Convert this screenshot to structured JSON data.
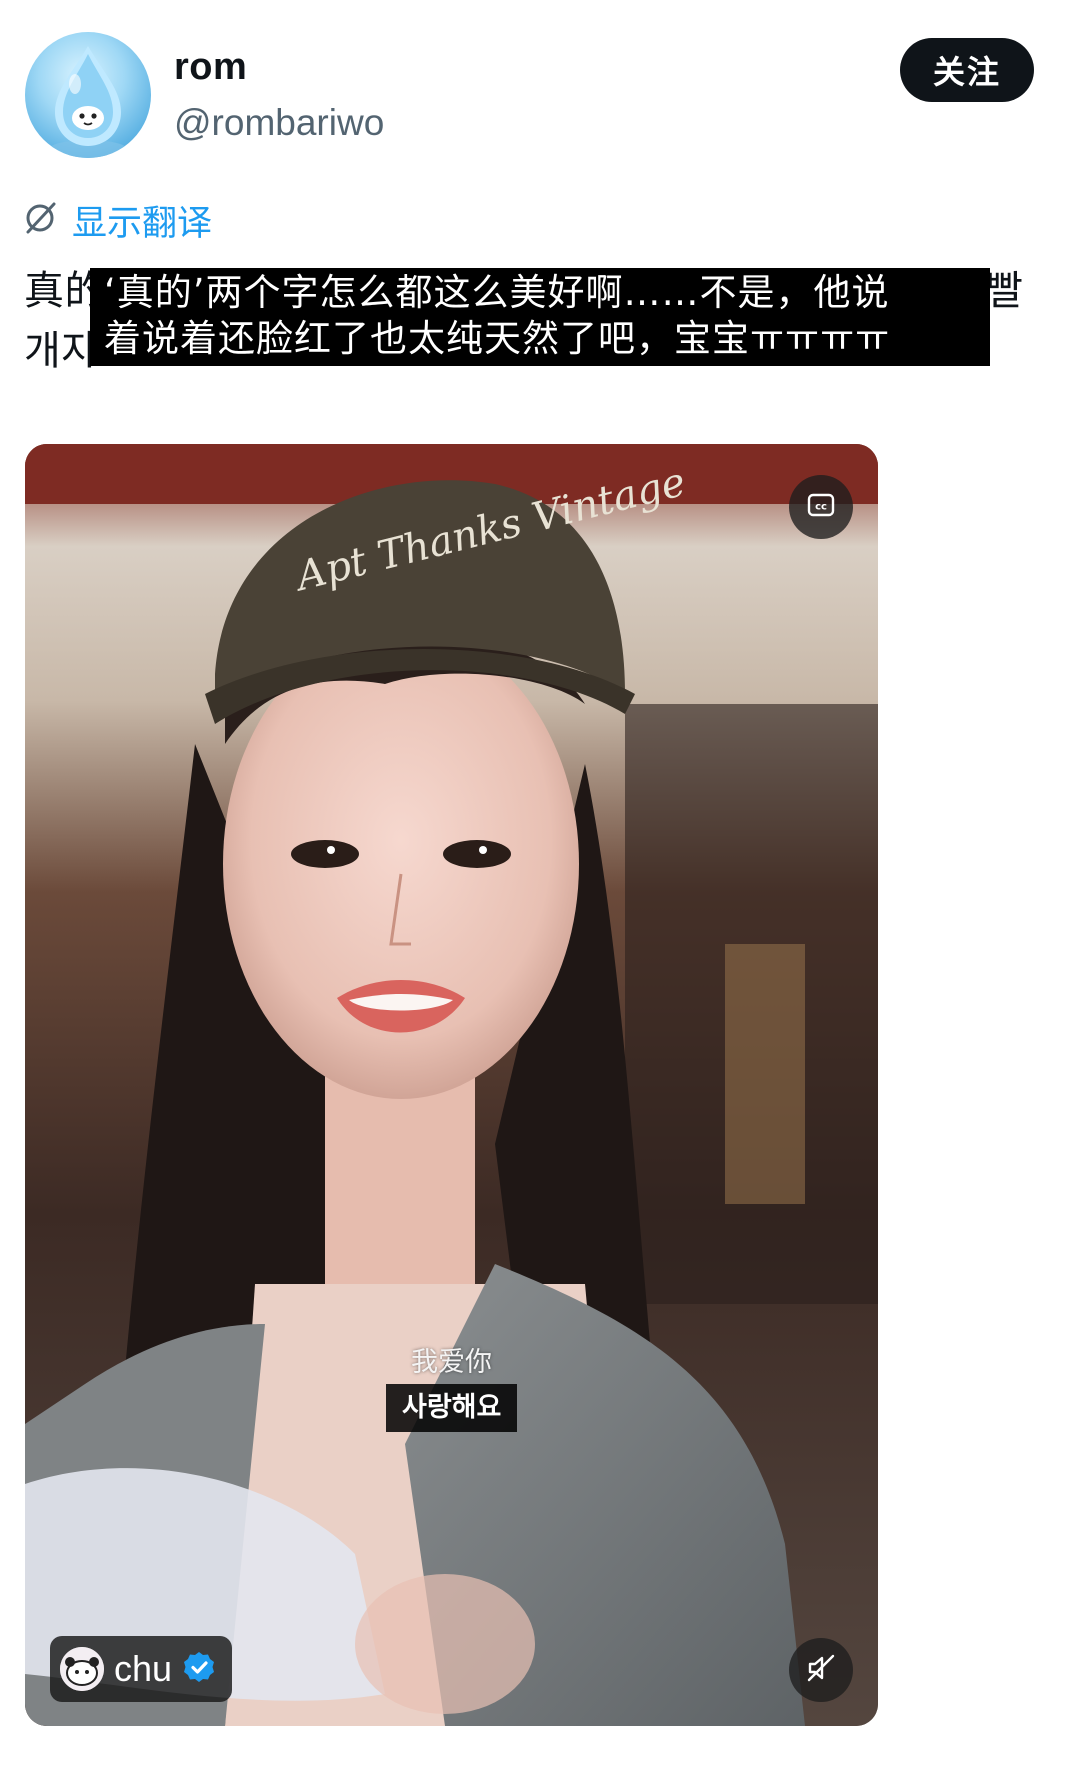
{
  "author": {
    "name": "rom",
    "handle": "@rombariwo"
  },
  "follow_button": {
    "label": "关注"
  },
  "translate": {
    "label": "显示翻译",
    "icon": "globe-slash-icon"
  },
  "tweet": {
    "original_line_1_start": "真的",
    "original_line_1_end": "빨",
    "original_line_2_start": "개자",
    "subtitle_line_1": "‘真的’两个字怎么都这么美好啊……不是，他说",
    "subtitle_line_2": "着说着还脸红了也太纯天然了吧，宝宝ㅠㅠㅠㅠ"
  },
  "video": {
    "cap_text": "Apt Thanks Vintage",
    "subtitle_cn": "我爱你",
    "subtitle_kr": "사랑해요",
    "creator_name": "chu",
    "cc_icon": "closed-captions-icon",
    "mute_icon": "speaker-muted-icon",
    "verified_icon": "verified-badge-icon"
  },
  "colors": {
    "accent": "#1d9bf0",
    "follow_bg": "#0f1419",
    "handle": "#536471"
  }
}
